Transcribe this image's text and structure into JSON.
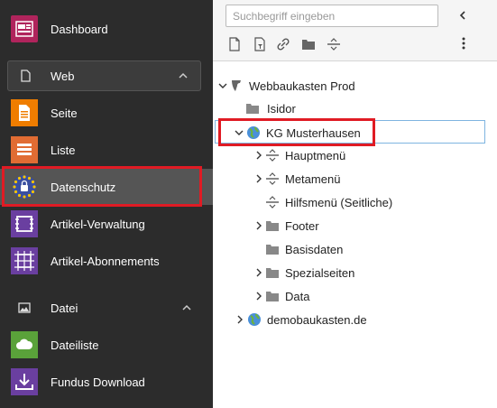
{
  "module_menu": {
    "dashboard": {
      "label": "Dashboard",
      "icon": "dashboard-icon"
    },
    "web_group": {
      "label": "Web",
      "icon": "page-icon"
    },
    "web_items": [
      {
        "label": "Seite",
        "icon": "page-module-icon",
        "color": "#ef7d00"
      },
      {
        "label": "Liste",
        "icon": "list-module-icon",
        "color": "#e16c33"
      },
      {
        "label": "Datenschutz",
        "icon": "privacy-eu-icon",
        "color": "#3a4fa0"
      },
      {
        "label": "Artikel-Verwaltung",
        "icon": "article-management-icon",
        "color": "#6a3fa0"
      },
      {
        "label": "Artikel-Abonnements",
        "icon": "article-subscriptions-icon",
        "color": "#6a3fa0"
      }
    ],
    "datei_group": {
      "label": "Datei",
      "icon": "image-icon"
    },
    "datei_items": [
      {
        "label": "Dateiliste",
        "icon": "filelist-icon",
        "color": "#5aa23a"
      },
      {
        "label": "Fundus Download",
        "icon": "download-icon",
        "color": "#6a3fa0"
      }
    ]
  },
  "tree_toolbar": {
    "search_placeholder": "Suchbegriff eingeben",
    "tools": [
      "new-page-icon",
      "filter-page-icon",
      "link-icon",
      "folder-icon",
      "separator-icon"
    ],
    "more": "more-icon"
  },
  "page_tree": {
    "root": {
      "label": "Webbaukasten Prod",
      "icon": "typo3-icon"
    },
    "nodes": [
      {
        "label": "Isidor",
        "icon": "folder-icon",
        "toggle": "none"
      },
      {
        "label": "KG Musterhausen",
        "icon": "globe-icon",
        "toggle": "expanded"
      },
      {
        "label": "Hauptmenü",
        "icon": "separator-icon",
        "toggle": "collapsed"
      },
      {
        "label": "Metamenü",
        "icon": "separator-icon",
        "toggle": "collapsed"
      },
      {
        "label": "Hilfsmenü (Seitliche)",
        "icon": "separator-icon",
        "toggle": "none"
      },
      {
        "label": "Footer",
        "icon": "folder-icon",
        "toggle": "collapsed"
      },
      {
        "label": "Basisdaten",
        "icon": "folder-icon",
        "toggle": "none"
      },
      {
        "label": "Spezialseiten",
        "icon": "folder-icon",
        "toggle": "collapsed"
      },
      {
        "label": "Data",
        "icon": "folder-icon",
        "toggle": "collapsed"
      },
      {
        "label": "demobaukasten.de",
        "icon": "globe-icon",
        "toggle": "collapsed"
      }
    ]
  },
  "colors": {
    "menu_bg": "#2c2c2c",
    "highlight_red": "#e01b24",
    "selected_border": "#7fb4e0"
  }
}
